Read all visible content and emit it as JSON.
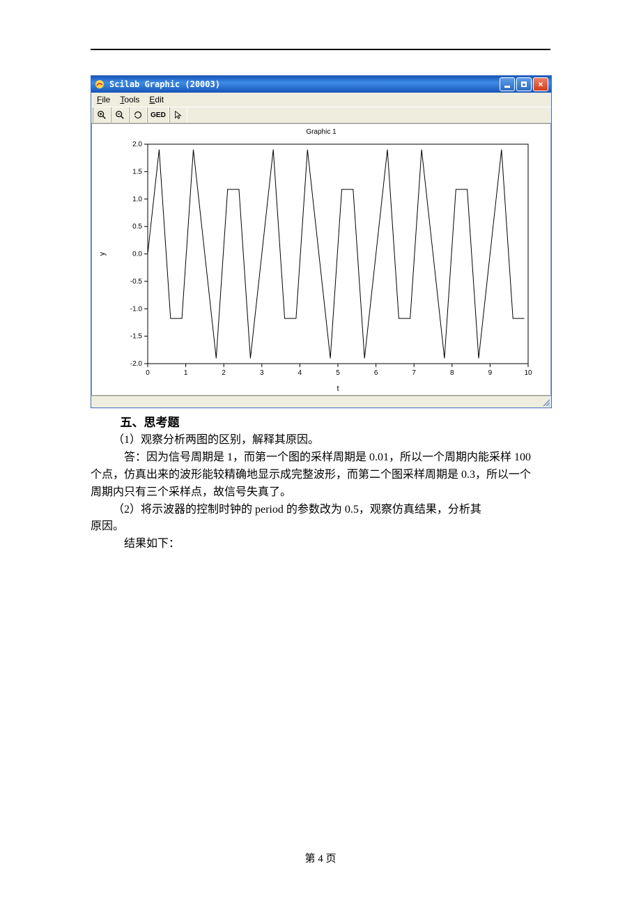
{
  "window": {
    "title": "Scilab Graphic (20003)",
    "menu": {
      "file": "File",
      "tools": "Tools",
      "edit": "Edit"
    },
    "toolbar": {
      "ged_label": "GED"
    },
    "graphic_title": "Graphic 1"
  },
  "chart_data": {
    "type": "line",
    "title": "Graphic 1",
    "xlabel": "t",
    "ylabel": "y",
    "xlim": [
      0,
      10
    ],
    "ylim": [
      -2.0,
      2.0
    ],
    "x_ticks": [
      0,
      1,
      2,
      3,
      4,
      5,
      6,
      7,
      8,
      9,
      10
    ],
    "y_ticks": [
      -2.0,
      -1.5,
      -1.0,
      -0.5,
      0.0,
      0.5,
      1.0,
      1.5,
      2.0
    ],
    "x": [
      0.0,
      0.3,
      0.6,
      0.9,
      1.2,
      1.5,
      1.8,
      2.1,
      2.4,
      2.7,
      3.0,
      3.3,
      3.6,
      3.9,
      4.2,
      4.5,
      4.8,
      5.1,
      5.4,
      5.7,
      6.0,
      6.3,
      6.6,
      6.9,
      7.2,
      7.5,
      7.8,
      8.1,
      8.4,
      8.7,
      9.0,
      9.3,
      9.6,
      9.9
    ],
    "y": [
      0.0,
      1.902,
      -1.176,
      -1.176,
      1.902,
      0.0,
      -1.902,
      1.176,
      1.176,
      -1.902,
      0.0,
      1.902,
      -1.176,
      -1.176,
      1.902,
      0.0,
      -1.902,
      1.176,
      1.176,
      -1.902,
      0.0,
      1.902,
      -1.176,
      -1.176,
      1.902,
      0.0,
      -1.902,
      1.176,
      1.176,
      -1.902,
      0.0,
      1.902,
      -1.176,
      -1.176
    ]
  },
  "doc": {
    "section_heading": "五、思考题",
    "q1": "（1）观察分析两图的区别，解释其原因。",
    "a1_line1": "答：因为信号周期是 1，而第一个图的采样周期是 0.01，所以一个周期内能采样 100",
    "a1_line2": "个点，仿真出来的波形能较精确地显示成完整波形，而第二个图采样周期是 0.3，所以一个",
    "a1_line3": "周期内只有三个采样点，故信号失真了。",
    "q2_line1": "（2）将示波器的控制时钟的 period 的参数改为 0.5，观察仿真结果，分析其",
    "q2_line2": "原因。",
    "result_label": "结果如下：",
    "page_number": "第 4 页"
  }
}
